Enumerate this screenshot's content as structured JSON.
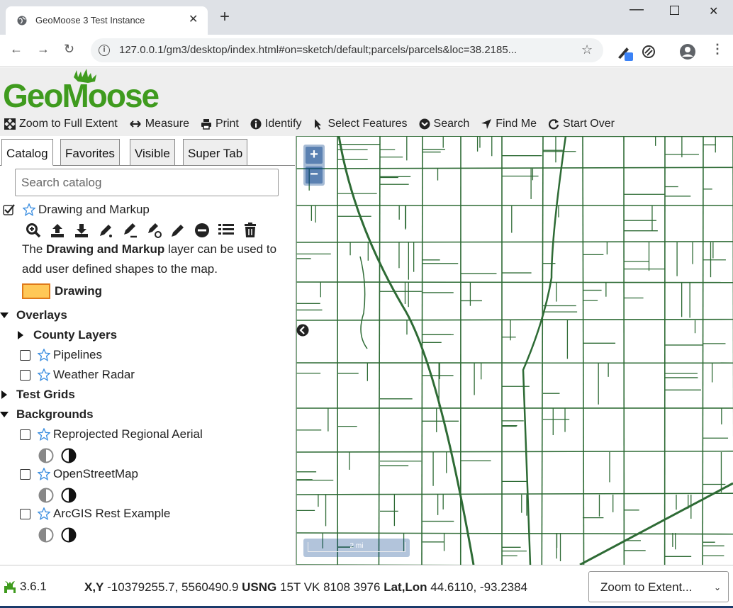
{
  "browser": {
    "tab_title": "GeoMoose 3 Test Instance",
    "url": "127.0.0.1/gm3/desktop/index.html#on=sketch/default;parcels/parcels&loc=38.2185..."
  },
  "app": {
    "logo_text": "GeoMoose",
    "toolbar": [
      {
        "label": "Zoom to Full Extent",
        "icon": "expand-icon"
      },
      {
        "label": "Measure",
        "icon": "arrows-horizontal-icon"
      },
      {
        "label": "Print",
        "icon": "printer-icon"
      },
      {
        "label": "Identify",
        "icon": "info-icon"
      },
      {
        "label": "Select Features",
        "icon": "pointer-icon"
      },
      {
        "label": "Search",
        "icon": "chevron-circle-icon"
      },
      {
        "label": "Find Me",
        "icon": "location-arrow-icon"
      },
      {
        "label": "Start Over",
        "icon": "refresh-icon"
      }
    ]
  },
  "panel": {
    "tabs": [
      "Catalog",
      "Favorites",
      "Visible",
      "Super Tab"
    ],
    "search_placeholder": "Search catalog",
    "drawing_layer": {
      "label": "Drawing and Markup",
      "checked": true,
      "desc_prefix": "The ",
      "desc_bold": "Drawing and Markup",
      "desc_suffix": " layer can be used to add user defined shapes to the map.",
      "legend_label": "Drawing",
      "legend_color": "#ffc857"
    },
    "overlays_label": "Overlays",
    "county_layers_label": "County Layers",
    "pipelines_label": "Pipelines",
    "weather_radar_label": "Weather Radar",
    "test_grids_label": "Test Grids",
    "backgrounds_label": "Backgrounds",
    "bg_layers": [
      "Reprojected Regional Aerial",
      "OpenStreetMap",
      "ArcGIS Rest Example"
    ]
  },
  "map": {
    "scale_label": "2 mi",
    "parcel_color": "#2e6b35"
  },
  "footer": {
    "version": "3.6.1",
    "xy_label": "X,Y",
    "xy_value": " -10379255.7, 5560490.9 ",
    "usng_label": "USNG",
    "usng_value": " 15T VK 8108 3976 ",
    "latlon_label": "Lat,Lon",
    "latlon_value": " 44.6110, -93.2384",
    "zoom_select": "Zoom to Extent..."
  }
}
